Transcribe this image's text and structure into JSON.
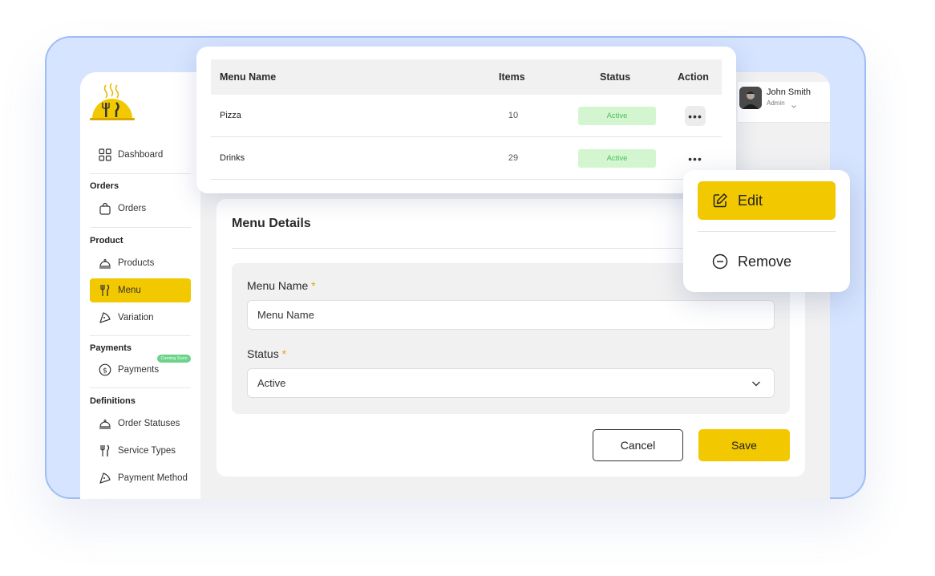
{
  "sidebar": {
    "dashboard": "Dashboard",
    "sections": {
      "orders": "Orders",
      "product": "Product",
      "payments": "Payments",
      "definitions": "Definitions"
    },
    "items": {
      "orders": "Orders",
      "products": "Products",
      "menu": "Menu",
      "variation": "Variation",
      "payments": "Payments",
      "order_statuses": "Order Statuses",
      "service_types": "Service Types",
      "payment_method": "Payment Method"
    },
    "coming_soon": "Coming Soon"
  },
  "user": {
    "name": "John Smith",
    "role": "Admin"
  },
  "table": {
    "headers": {
      "name": "Menu Name",
      "items": "Items",
      "status": "Status",
      "action": "Action"
    },
    "rows": [
      {
        "name": "Pizza",
        "items": "10",
        "status": "Active"
      },
      {
        "name": "Drinks",
        "items": "29",
        "status": "Active"
      }
    ]
  },
  "popup": {
    "edit": "Edit",
    "remove": "Remove"
  },
  "details": {
    "title": "Menu Details",
    "name_label": "Menu Name",
    "name_value": "Menu Name",
    "status_label": "Status",
    "status_value": "Active",
    "required_mark": "*",
    "cancel": "Cancel",
    "save": "Save"
  },
  "colors": {
    "accent": "#f2c800",
    "active_bg": "#d3f6d0",
    "active_text": "#48c05a",
    "backdrop": "#d6e4ff"
  }
}
